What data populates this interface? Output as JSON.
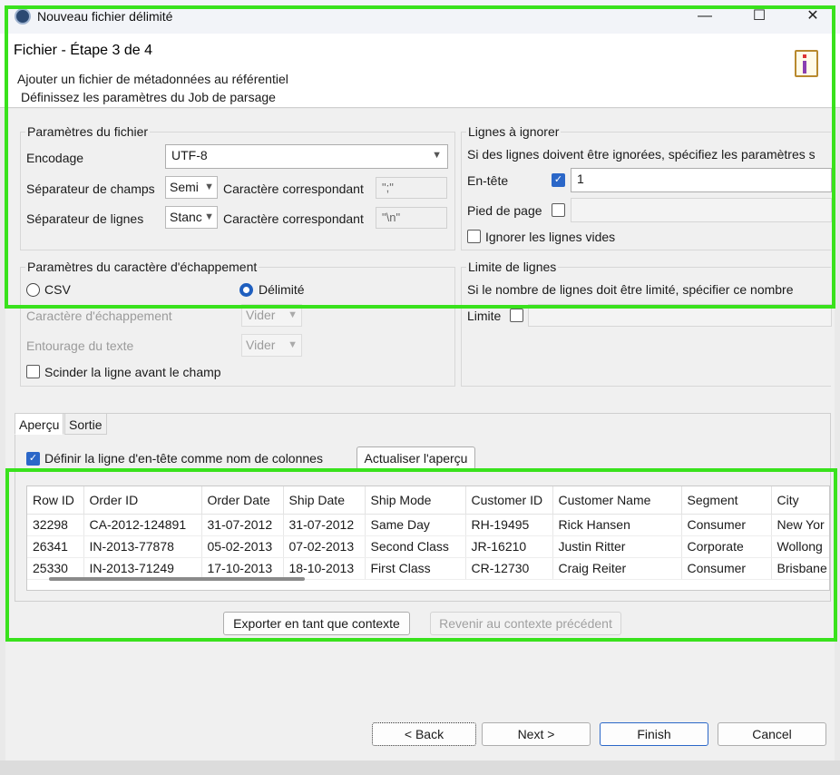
{
  "window": {
    "title": "Nouveau fichier délimité",
    "minimize": "—",
    "maximize": "☐",
    "close": "✕"
  },
  "header": {
    "step_title": "Fichier - Étape 3 de 4",
    "subtitle": "Ajouter un fichier de métadonnées au référentiel",
    "description": "Définissez les paramètres du Job de parsage"
  },
  "file_params": {
    "title": "Paramètres du fichier",
    "encoding_label": "Encodage",
    "encoding_value": "UTF-8",
    "field_sep_label": "Séparateur de champs",
    "field_sep_value": "Semi",
    "field_char_label": "Caractère correspondant",
    "field_char_value": "\";\"",
    "line_sep_label": "Séparateur de lignes",
    "line_sep_value": "Stanc",
    "line_char_label": "Caractère correspondant",
    "line_char_value": "\"\\n\""
  },
  "skip_lines": {
    "title": "Lignes à ignorer",
    "hint": "Si des lignes doivent être ignorées, spécifiez les paramètres s",
    "header_label": "En-tête",
    "header_value": "1",
    "footer_label": "Pied de page",
    "ignore_empty_label": "Ignorer les lignes vides"
  },
  "escape_params": {
    "title": "Paramètres du caractère d'échappement",
    "csv_label": "CSV",
    "delimited_label": "Délimité",
    "escape_char_label": "Caractère d'échappement",
    "escape_char_value": "Vider",
    "text_enclosure_label": "Entourage du texte",
    "text_enclosure_value": "Vider",
    "split_line_label": "Scinder la ligne avant le champ"
  },
  "line_limit": {
    "title": "Limite de lignes",
    "hint": "Si le nombre de lignes doit être limité, spécifier ce nombre",
    "limit_label": "Limite"
  },
  "tabs": {
    "preview": "Aperçu",
    "output": "Sortie"
  },
  "preview": {
    "header_as_colnames_label": "Définir la ligne d'en-tête comme nom de colonnes",
    "refresh_button": "Actualiser l'aperçu",
    "columns": [
      "Row ID",
      "Order ID",
      "Order Date",
      "Ship Date",
      "Ship Mode",
      "Customer ID",
      "Customer Name",
      "Segment",
      "City"
    ],
    "rows": [
      [
        "32298",
        "CA-2012-124891",
        "31-07-2012",
        "31-07-2012",
        "Same Day",
        "RH-19495",
        "Rick Hansen",
        "Consumer",
        "New Yor"
      ],
      [
        "26341",
        "IN-2013-77878",
        "05-02-2013",
        "07-02-2013",
        "Second Class",
        "JR-16210",
        "Justin Ritter",
        "Corporate",
        "Wollong"
      ],
      [
        "25330",
        "IN-2013-71249",
        "17-10-2013",
        "18-10-2013",
        "First Class",
        "CR-12730",
        "Craig Reiter",
        "Consumer",
        "Brisbane"
      ]
    ]
  },
  "context_buttons": {
    "export": "Exporter en tant que contexte",
    "revert": "Revenir au contexte précédent"
  },
  "footer": {
    "back": "< Back",
    "next": "Next >",
    "finish": "Finish",
    "cancel": "Cancel"
  }
}
